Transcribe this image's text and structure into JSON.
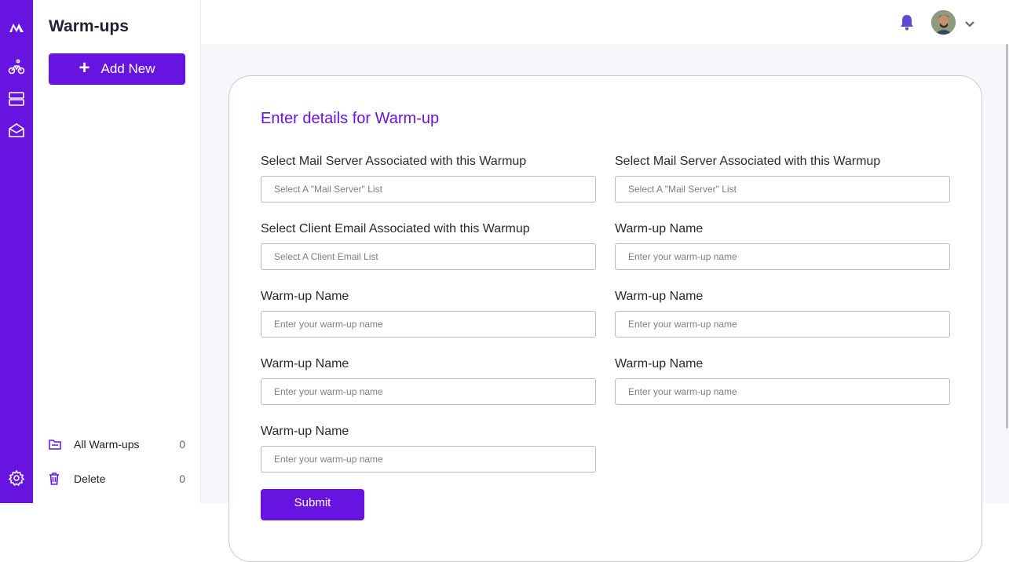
{
  "sidebar": {
    "title": "Warm-ups",
    "add_label": "Add New",
    "items": [
      {
        "label": "All Warm-ups",
        "count": "0"
      },
      {
        "label": "Delete",
        "count": "0"
      }
    ]
  },
  "form": {
    "title": "Enter details for Warm-up",
    "fields": [
      {
        "label": "Select Mail Server Associated with this Warmup",
        "placeholder": "Select A \"Mail Server\" List"
      },
      {
        "label": "Select Mail Server Associated with this Warmup",
        "placeholder": "Select A \"Mail Server\" List"
      },
      {
        "label": "Select Client Email Associated with this Warmup",
        "placeholder": "Select A Client Email List"
      },
      {
        "label": "Warm-up Name",
        "placeholder": "Enter your warm-up name"
      },
      {
        "label": "Warm-up Name",
        "placeholder": "Enter your warm-up name"
      },
      {
        "label": "Warm-up Name",
        "placeholder": "Enter your warm-up name"
      },
      {
        "label": "Warm-up Name",
        "placeholder": "Enter your warm-up name"
      },
      {
        "label": "Warm-up Name",
        "placeholder": "Enter your warm-up name"
      },
      {
        "label": "Warm-up Name",
        "placeholder": "Enter your warm-up name"
      }
    ],
    "submit_label": "Submit"
  },
  "icons": {
    "rail": [
      "logo-icon",
      "bike-icon",
      "server-icon",
      "mail-open-icon",
      "settings-icon"
    ],
    "topbar": [
      "bell-icon",
      "avatar",
      "chevron-down-icon"
    ]
  },
  "colors": {
    "accent": "#6714e0",
    "bell": "#5b4bd6"
  }
}
